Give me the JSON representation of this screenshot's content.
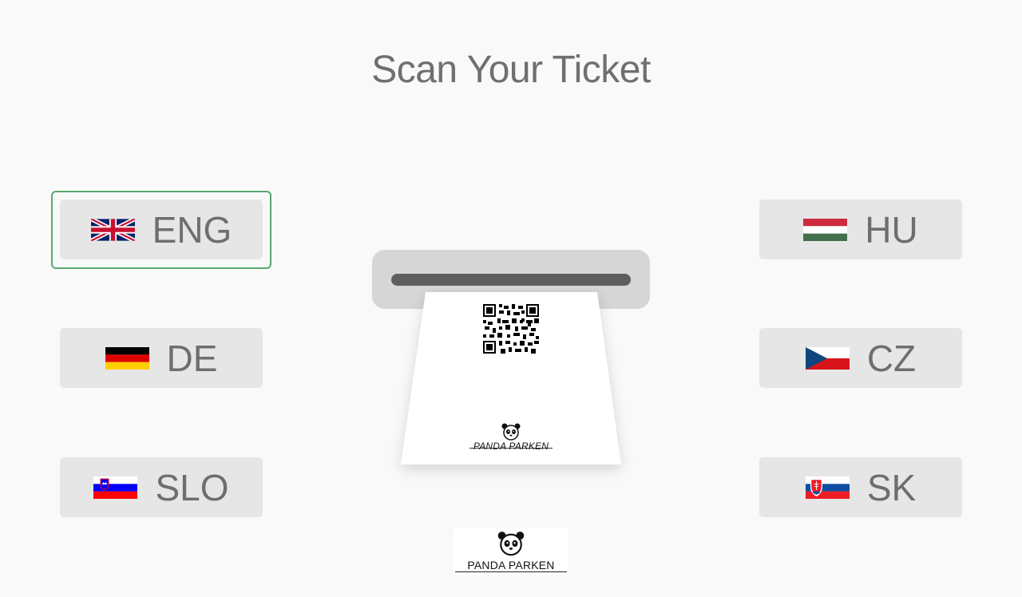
{
  "page": {
    "title": "Scan Your Ticket",
    "selected_language": "ENG"
  },
  "languages": {
    "eng": {
      "code": "ENG",
      "flag_icon": "uk-flag-icon"
    },
    "de": {
      "code": "DE",
      "flag_icon": "germany-flag-icon"
    },
    "slo": {
      "code": "SLO",
      "flag_icon": "slovenia-flag-icon"
    },
    "hu": {
      "code": "HU",
      "flag_icon": "hungary-flag-icon"
    },
    "cz": {
      "code": "CZ",
      "flag_icon": "czech-flag-icon"
    },
    "sk": {
      "code": "SK",
      "flag_icon": "slovakia-flag-icon"
    }
  },
  "ticket": {
    "brand": "PANDA PARKEN"
  },
  "footer": {
    "brand": "PANDA PARKEN"
  },
  "colors": {
    "button_bg": "#e6e6e6",
    "selected_border": "#5aa86e",
    "text": "#6e6e6e"
  }
}
